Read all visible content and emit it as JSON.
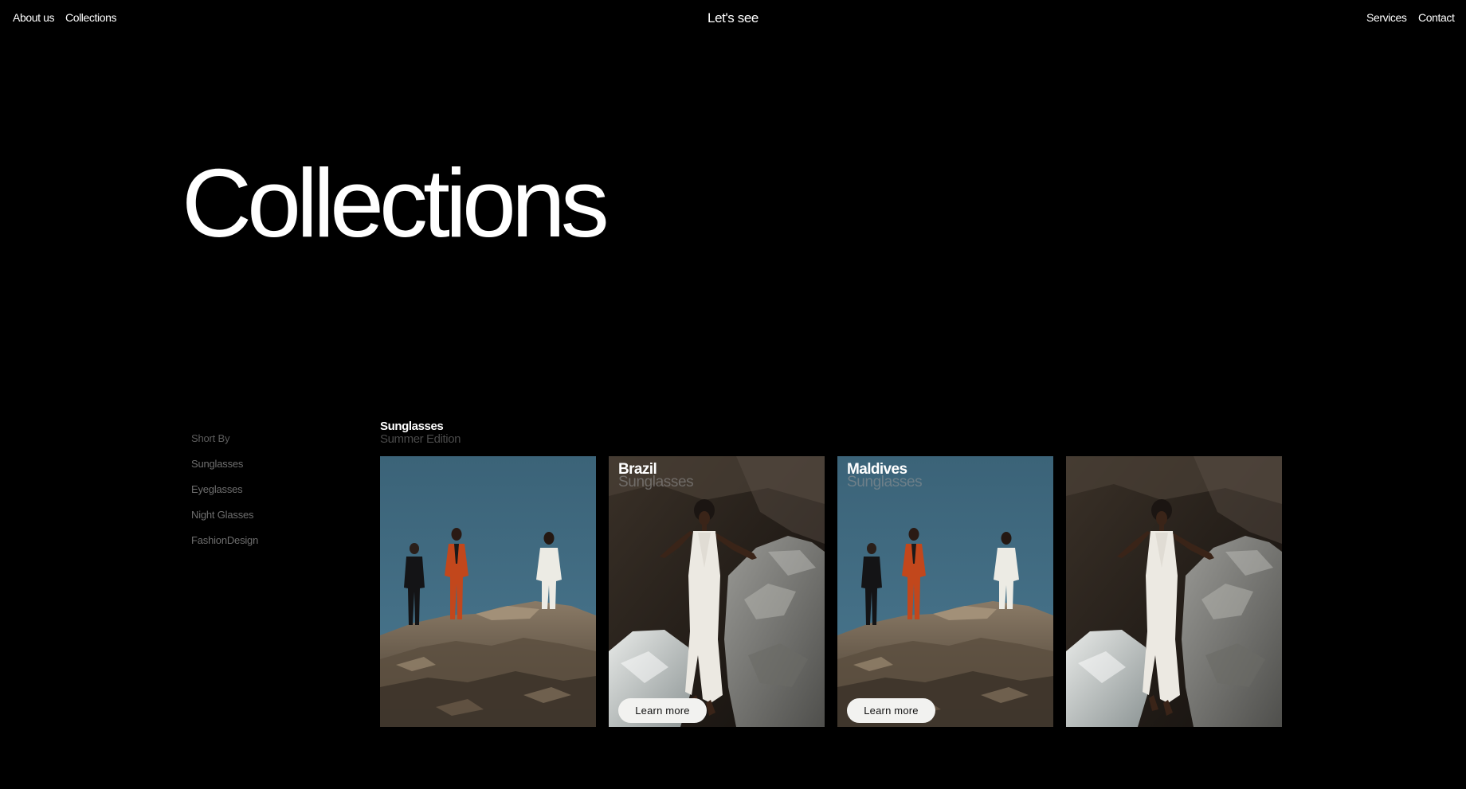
{
  "nav": {
    "about": "About us",
    "collections": "Collections",
    "brand": "Let's see",
    "services": "Services",
    "contact": "Contact"
  },
  "hero": {
    "title": "Collections"
  },
  "sidebar": {
    "heading": "Short By",
    "items": [
      {
        "label": "Sunglasses"
      },
      {
        "label": "Eyeglasses"
      },
      {
        "label": "Night Glasses"
      },
      {
        "label": "FashionDesign"
      }
    ]
  },
  "section": {
    "title": "Sunglasses",
    "subtitle": "Summer Edition"
  },
  "cards": [
    {
      "title": "",
      "subtitle": "",
      "button": "",
      "scene": "three-figures-on-rocks"
    },
    {
      "title": "Brazil",
      "subtitle": "Sunglasses",
      "button": "Learn more",
      "scene": "woman-white-dress-rocks"
    },
    {
      "title": "Maldives",
      "subtitle": "Sunglasses",
      "button": "Learn more",
      "scene": "three-figures-on-rocks"
    },
    {
      "title": "",
      "subtitle": "",
      "button": "",
      "scene": "woman-white-dress-rocks"
    }
  ],
  "colors": {
    "background": "#000000",
    "text": "#ffffff",
    "muted": "#6e6e6e",
    "sky": "#3f6a82",
    "button_bg": "#f2f2f0"
  }
}
